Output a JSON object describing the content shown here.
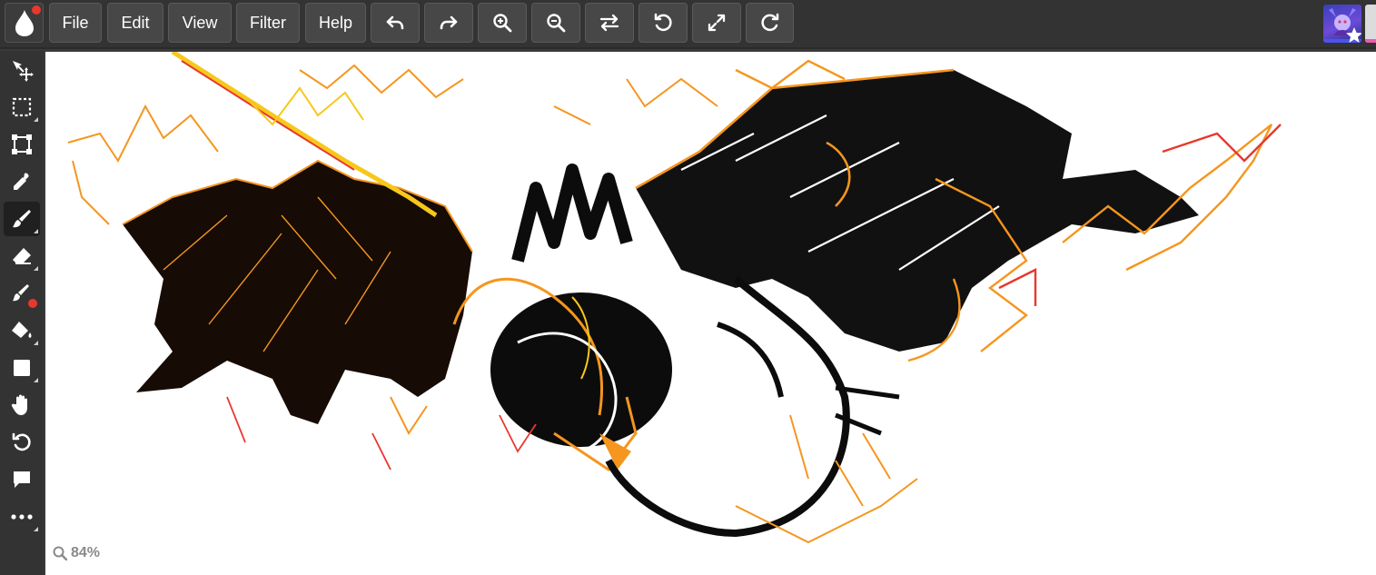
{
  "menu": {
    "file": "File",
    "edit": "Edit",
    "view": "View",
    "filter": "Filter",
    "help": "Help"
  },
  "toolbar_icons": [
    "undo-icon",
    "redo-icon",
    "zoom-in-icon",
    "zoom-out-icon",
    "flip-icon",
    "rotate-left-icon",
    "fullscreen-icon",
    "reset-icon"
  ],
  "tools": [
    "move-tool",
    "select-tool",
    "transform-tool",
    "eyedropper-tool",
    "brush-tool",
    "eraser-tool",
    "blend-tool",
    "fill-tool",
    "shape-tool",
    "hand-tool",
    "rotate-tool",
    "comment-tool",
    "more-tools"
  ],
  "active_tool": "brush-tool",
  "zoom": {
    "level": "84%"
  },
  "colors": {
    "accent_red": "#e8382e",
    "ui_bg": "#333333",
    "button_bg": "#474747",
    "stroke_orange": "#f5961e",
    "stroke_yellow": "#f7c81a",
    "stroke_red": "#e8382e"
  }
}
